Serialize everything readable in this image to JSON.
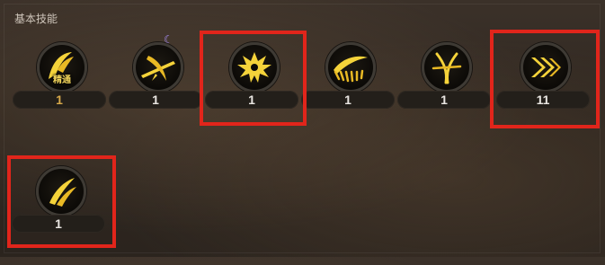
{
  "section": {
    "title": "基本技能"
  },
  "skills": [
    {
      "icon": "crescent-slash-icon",
      "level": "1",
      "badge": "精通",
      "level_style": "gold"
    },
    {
      "icon": "sword-cross-slash-icon",
      "level": "1",
      "moon": "☾",
      "level_style": "white"
    },
    {
      "icon": "spiked-beast-icon",
      "level": "1",
      "level_style": "white"
    },
    {
      "icon": "sweeping-arc-icon",
      "level": "1",
      "level_style": "white"
    },
    {
      "icon": "triple-slash-icon",
      "level": "1",
      "level_style": "white"
    },
    {
      "icon": "double-chevron-icon",
      "level": "11",
      "level_style": "white"
    },
    {
      "icon": "twin-blade-icon",
      "level": "1",
      "level_style": "white"
    }
  ],
  "colors": {
    "highlight": "#e1251b",
    "icon_gold": "#f5d33a"
  }
}
